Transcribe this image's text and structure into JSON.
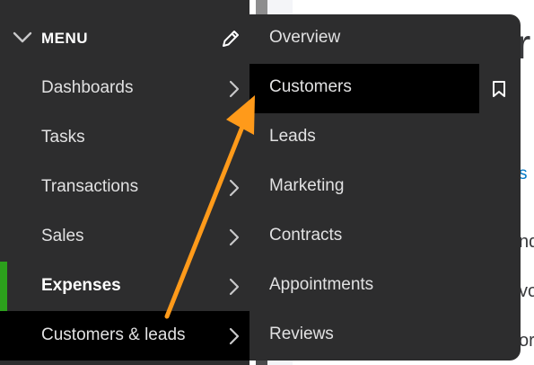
{
  "menu": {
    "title": "MENU",
    "icons": {
      "collapse": "chevron-down-icon",
      "edit": "pencil-icon"
    },
    "items": [
      {
        "label": "Dashboards",
        "has_submenu": true
      },
      {
        "label": "Tasks",
        "has_submenu": false
      },
      {
        "label": "Transactions",
        "has_submenu": true
      },
      {
        "label": "Sales",
        "has_submenu": true
      },
      {
        "label": "Expenses",
        "has_submenu": true
      },
      {
        "label": "Customers & leads",
        "has_submenu": true
      }
    ]
  },
  "submenu": {
    "items": [
      {
        "label": "Overview"
      },
      {
        "label": "Customers"
      },
      {
        "label": "Leads"
      },
      {
        "label": "Marketing"
      },
      {
        "label": "Contracts"
      },
      {
        "label": "Appointments"
      },
      {
        "label": "Reviews"
      }
    ],
    "bookmark_icon": "bookmark-icon"
  },
  "background_text": {
    "big": "r",
    "link": "s",
    "line1": "nd",
    "line2": "vo",
    "line3": "or"
  },
  "colors": {
    "sidebar": "#2d2d2e",
    "active": "#000000",
    "accent_green": "#2ca01c",
    "annotation_arrow": "#ff9a1a"
  }
}
